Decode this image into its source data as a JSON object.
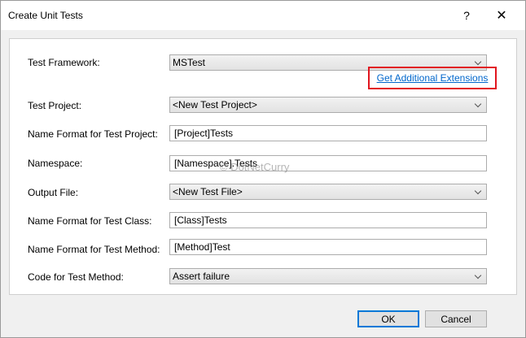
{
  "window": {
    "title": "Create Unit Tests",
    "help_glyph": "?",
    "close_glyph": "✕"
  },
  "form": {
    "test_framework": {
      "label": "Test Framework:",
      "value": "MSTest"
    },
    "extensions_link": "Get Additional Extensions",
    "test_project": {
      "label": "Test Project:",
      "value": "<New Test Project>"
    },
    "name_format_project": {
      "label": "Name Format for Test Project:",
      "value": "[Project]Tests"
    },
    "namespace": {
      "label": "Namespace:",
      "value": "[Namespace].Tests"
    },
    "output_file": {
      "label": "Output File:",
      "value": "<New Test File>"
    },
    "name_format_class": {
      "label": "Name Format for Test Class:",
      "value": "[Class]Tests"
    },
    "name_format_method": {
      "label": "Name Format for Test Method:",
      "value": "[Method]Test"
    },
    "code_for_method": {
      "label": "Code for Test Method:",
      "value": "Assert failure"
    }
  },
  "watermark": "© DotNetCurry",
  "buttons": {
    "ok": "OK",
    "cancel": "Cancel"
  },
  "colors": {
    "highlight_box": "#e1151e",
    "link": "#0066cc",
    "default_button_border": "#0078d7"
  }
}
